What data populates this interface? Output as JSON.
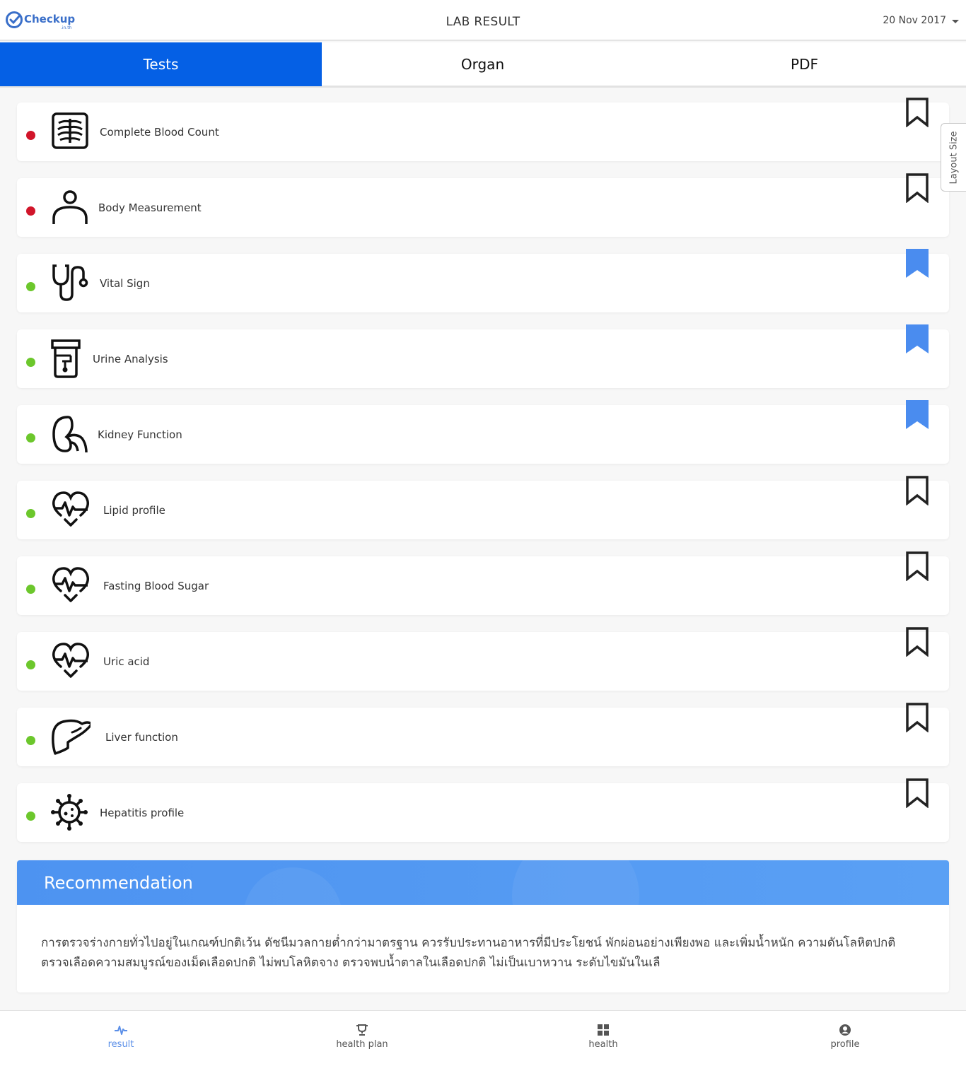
{
  "header": {
    "logo_text": "Checkup",
    "logo_sub": ".in.th",
    "title": "LAB RESULT",
    "date": "20 Nov 2017"
  },
  "tabs": [
    {
      "label": "Tests",
      "active": true
    },
    {
      "label": "Organ",
      "active": false
    },
    {
      "label": "PDF",
      "active": false
    }
  ],
  "tests": [
    {
      "label": "Complete Blood Count",
      "status": "red",
      "icon": "xray-chest-icon",
      "bookmarked": false
    },
    {
      "label": "Body Measurement",
      "status": "red",
      "icon": "person-icon",
      "bookmarked": false
    },
    {
      "label": "Vital Sign",
      "status": "green",
      "icon": "stethoscope-icon",
      "bookmarked": true
    },
    {
      "label": "Urine Analysis",
      "status": "green",
      "icon": "urine-cup-icon",
      "bookmarked": true
    },
    {
      "label": "Kidney Function",
      "status": "green",
      "icon": "kidney-icon",
      "bookmarked": true
    },
    {
      "label": "Lipid profile",
      "status": "green",
      "icon": "heart-pulse-icon",
      "bookmarked": false
    },
    {
      "label": "Fasting Blood Sugar",
      "status": "green",
      "icon": "heart-pulse-icon",
      "bookmarked": false
    },
    {
      "label": "Uric acid",
      "status": "green",
      "icon": "heart-pulse-icon",
      "bookmarked": false
    },
    {
      "label": "Liver function",
      "status": "green",
      "icon": "liver-icon",
      "bookmarked": false
    },
    {
      "label": "Hepatitis profile",
      "status": "green",
      "icon": "virus-icon",
      "bookmarked": false
    }
  ],
  "side_tab": {
    "label": "Layout Size"
  },
  "recommendation": {
    "title": "Recommendation",
    "text": "การตรวจร่างกายทั่วไปอยู่ในเกณฑ์ปกติเว้น ดัชนีมวลกายต่ำกว่ามาตรฐาน ควรรับประทานอาหารที่มีประโยชน์ พักผ่อนอย่างเพียงพอ และเพิ่มน้ำหนัก ความดันโลหิตปกติ ตรวจเลือดความสมบูรณ์ของเม็ดเลือดปกติ ไม่พบโลหิตจาง ตรวจพบน้ำตาลในเลือดปกติ ไม่เป็นเบาหวาน ระดับไขมันในเลื"
  },
  "bottom_nav": [
    {
      "label": "result",
      "icon": "pulse-icon",
      "active": true
    },
    {
      "label": "health plan",
      "icon": "trophy-icon",
      "active": false
    },
    {
      "label": "health",
      "icon": "grid-icon",
      "active": false
    },
    {
      "label": "profile",
      "icon": "user-circle-icon",
      "active": false
    }
  ],
  "colors": {
    "primary": "#0560e5",
    "status_red": "#d1152a",
    "status_green": "#6cc72c",
    "bookmark_active": "#4a8cef",
    "recommendation_header": "#4d93f1"
  }
}
